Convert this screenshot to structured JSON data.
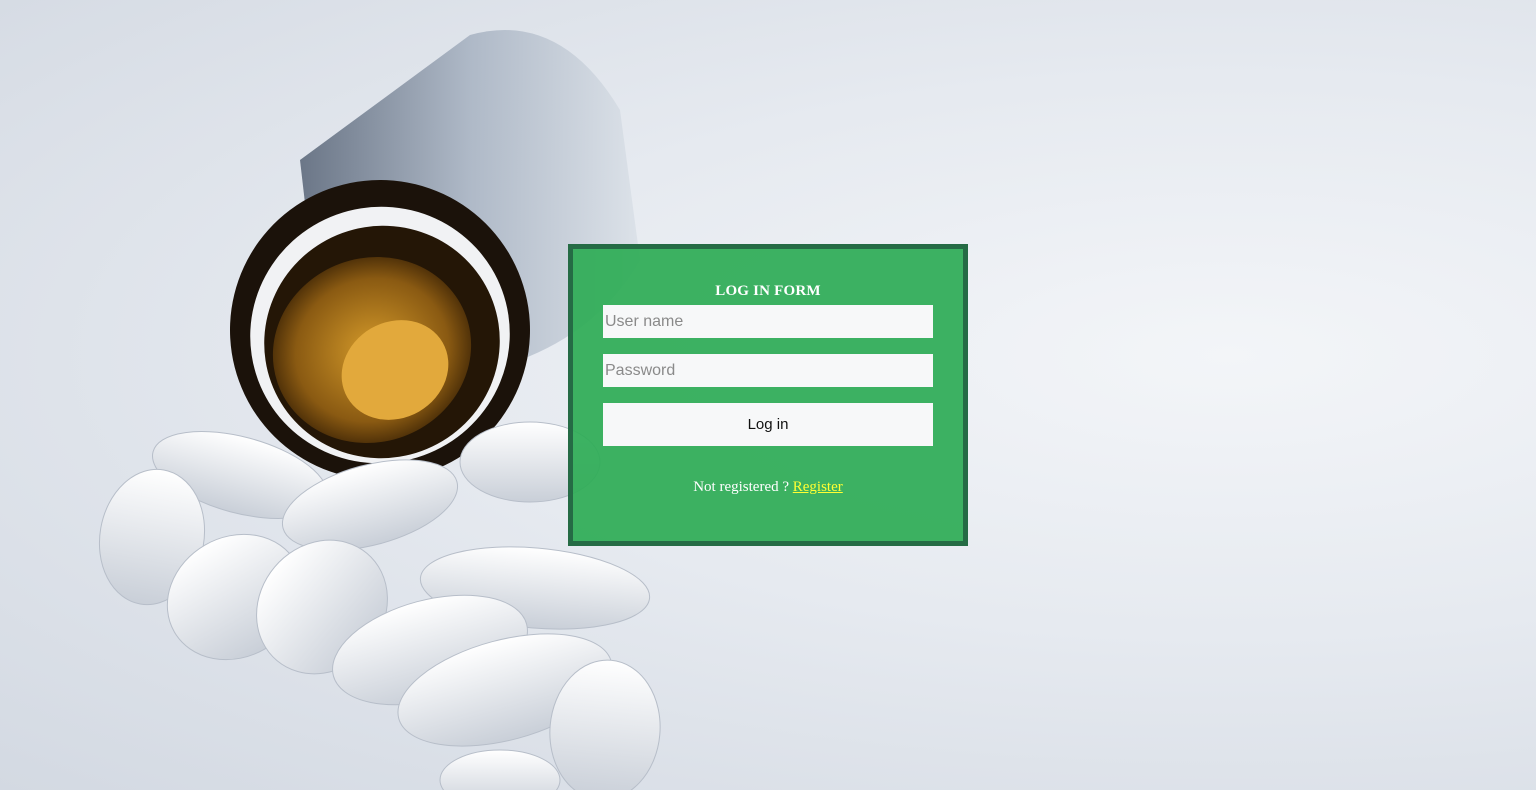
{
  "form": {
    "title": "LOG IN FORM",
    "username_placeholder": "User name",
    "password_placeholder": "Password",
    "login_label": "Log in",
    "register_prompt": "Not registered ? ",
    "register_link": "Register"
  },
  "colors": {
    "panel": "#2eac56",
    "panel_border": "#256b45",
    "link": "#ffff33"
  }
}
